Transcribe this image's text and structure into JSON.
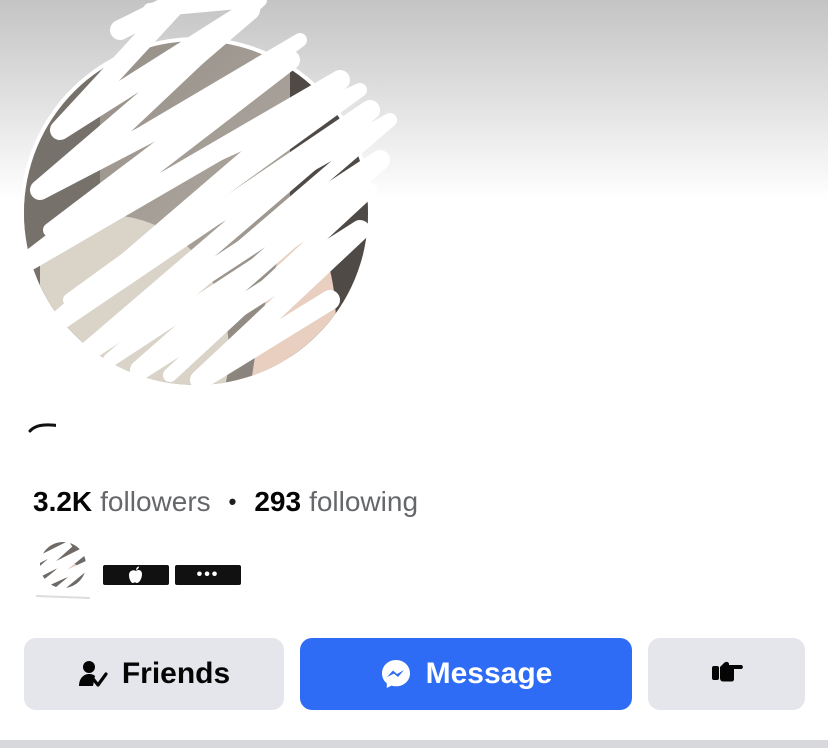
{
  "profile": {
    "followers_count": "3.2K",
    "followers_label": "followers",
    "separator": "•",
    "following_count": "293",
    "following_label": "following"
  },
  "mutual": {
    "pills": [
      {
        "icon": "apple-icon"
      },
      {
        "icon": "more-dots-icon",
        "text": "•••"
      }
    ]
  },
  "actions": {
    "friends_label": "Friends",
    "friends_icon": "friend-check-icon",
    "message_label": "Message",
    "message_icon": "messenger-icon",
    "more_icon": "pointing-hand-icon"
  },
  "colors": {
    "message_button": "#2f6cf5",
    "secondary_button": "#e4e6eb"
  }
}
